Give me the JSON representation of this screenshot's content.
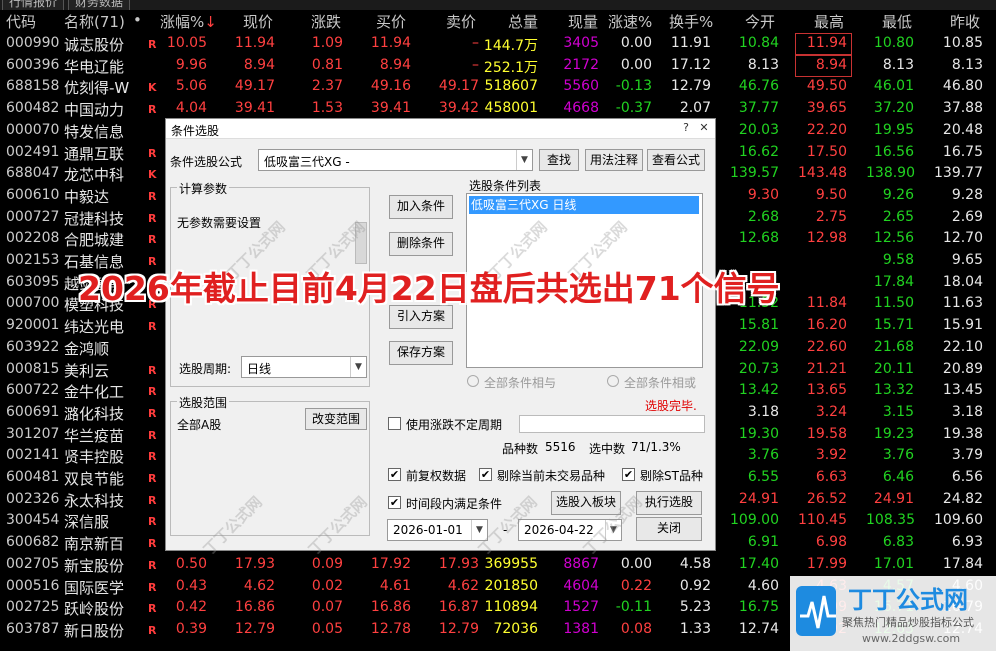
{
  "tabs": [
    "行情报价",
    "财务数据"
  ],
  "header": {
    "code": "代码",
    "name": "名称(71)",
    "dot": "•",
    "pct": "涨幅%",
    "pct_arrow": "↓",
    "price": "现价",
    "chg": "涨跌",
    "bid": "买价",
    "ask": "卖价",
    "vol": "总量",
    "cur": "现量",
    "speed": "涨速%",
    "turn": "换手%",
    "open": "今开",
    "high": "最高",
    "low": "最低",
    "prev": "昨收"
  },
  "colors": {
    "up": "#ff4040",
    "down": "#21d321",
    "flat": "#e8e8e8",
    "volume": "#ffff30",
    "current": "#d000d0"
  },
  "rows": [
    {
      "code": "000990",
      "name": "诚志股份",
      "mark": "R",
      "pct": "10.05",
      "price": "11.94",
      "chg": "1.09",
      "bid": "11.94",
      "ask": "–",
      "vol": "144.7万",
      "cur": "3405",
      "speed": "0.00",
      "turn": "11.91",
      "open": "10.84",
      "high": "11.94",
      "low": "10.80",
      "prev": "10.85"
    },
    {
      "code": "600396",
      "name": "华电辽能",
      "mark": "",
      "pct": "9.96",
      "price": "8.94",
      "chg": "0.81",
      "bid": "8.94",
      "ask": "–",
      "vol": "252.1万",
      "cur": "2172",
      "speed": "0.00",
      "turn": "17.12",
      "open": "8.13",
      "high": "8.94",
      "low": "8.13",
      "prev": "8.13"
    },
    {
      "code": "688158",
      "name": "优刻得-W",
      "mark": "K",
      "pct": "5.06",
      "price": "49.17",
      "chg": "2.37",
      "bid": "49.16",
      "ask": "49.17",
      "vol": "518607",
      "cur": "5560",
      "speed": "-0.13",
      "turn": "12.79",
      "open": "46.76",
      "high": "49.50",
      "low": "46.01",
      "prev": "46.80"
    },
    {
      "code": "600482",
      "name": "中国动力",
      "mark": "R",
      "pct": "4.04",
      "price": "39.41",
      "chg": "1.53",
      "bid": "39.41",
      "ask": "39.42",
      "vol": "458001",
      "cur": "4668",
      "speed": "-0.37",
      "turn": "2.07",
      "open": "37.77",
      "high": "39.65",
      "low": "37.20",
      "prev": "37.88"
    },
    {
      "code": "000070",
      "name": "特发信息",
      "mark": "",
      "pct": "",
      "price": "",
      "chg": "",
      "bid": "",
      "ask": "",
      "vol": "",
      "cur": "",
      "speed": "",
      "turn": "",
      "open": "20.03",
      "high": "22.20",
      "low": "19.95",
      "prev": "20.48"
    },
    {
      "code": "002491",
      "name": "通鼎互联",
      "mark": "R",
      "pct": "",
      "price": "",
      "chg": "",
      "bid": "",
      "ask": "",
      "vol": "",
      "cur": "",
      "speed": "",
      "turn": "",
      "open": "16.62",
      "high": "17.50",
      "low": "16.56",
      "prev": "16.75"
    },
    {
      "code": "688047",
      "name": "龙芯中科",
      "mark": "K",
      "pct": "",
      "price": "",
      "chg": "",
      "bid": "",
      "ask": "",
      "vol": "",
      "cur": "",
      "speed": "",
      "turn": "",
      "open": "139.57",
      "high": "143.48",
      "low": "138.90",
      "prev": "139.77"
    },
    {
      "code": "600610",
      "name": "中毅达",
      "mark": "R",
      "pct": "",
      "price": "",
      "chg": "",
      "bid": "",
      "ask": "",
      "vol": "",
      "cur": "",
      "speed": "",
      "turn": "",
      "open": "9.30",
      "high": "9.50",
      "low": "9.26",
      "prev": "9.28"
    },
    {
      "code": "000727",
      "name": "冠捷科技",
      "mark": "R",
      "pct": "",
      "price": "",
      "chg": "",
      "bid": "",
      "ask": "",
      "vol": "",
      "cur": "",
      "speed": "",
      "turn": "",
      "open": "2.68",
      "high": "2.75",
      "low": "2.65",
      "prev": "2.69"
    },
    {
      "code": "002208",
      "name": "合肥城建",
      "mark": "R",
      "pct": "",
      "price": "",
      "chg": "",
      "bid": "",
      "ask": "",
      "vol": "",
      "cur": "",
      "speed": "",
      "turn": "",
      "open": "12.68",
      "high": "12.98",
      "low": "12.56",
      "prev": "12.70"
    },
    {
      "code": "002153",
      "name": "石基信息",
      "mark": "R",
      "pct": "",
      "price": "",
      "chg": "",
      "bid": "",
      "ask": "",
      "vol": "",
      "cur": "",
      "speed": "",
      "turn": "",
      "open": "",
      "high": "",
      "low": "9.58",
      "prev": "9.65"
    },
    {
      "code": "603095",
      "name": "越剑智能",
      "mark": "",
      "pct": "",
      "price": "",
      "chg": "",
      "bid": "",
      "ask": "",
      "vol": "",
      "cur": "",
      "speed": "",
      "turn": "",
      "open": "",
      "high": "",
      "low": "17.84",
      "prev": "18.04"
    },
    {
      "code": "000700",
      "name": "模塑科技",
      "mark": "R",
      "pct": "",
      "price": "",
      "chg": "",
      "bid": "",
      "ask": "",
      "vol": "",
      "cur": "",
      "speed": "",
      "turn": "",
      "open": "11.52",
      "high": "11.84",
      "low": "11.50",
      "prev": "11.63"
    },
    {
      "code": "920001",
      "name": "纬达光电",
      "mark": "R",
      "pct": "",
      "price": "",
      "chg": "",
      "bid": "",
      "ask": "",
      "vol": "",
      "cur": "",
      "speed": "",
      "turn": "",
      "open": "15.81",
      "high": "16.20",
      "low": "15.71",
      "prev": "15.91"
    },
    {
      "code": "603922",
      "name": "金鸿顺",
      "mark": "",
      "pct": "",
      "price": "",
      "chg": "",
      "bid": "",
      "ask": "",
      "vol": "",
      "cur": "",
      "speed": "",
      "turn": "",
      "open": "22.09",
      "high": "22.60",
      "low": "21.68",
      "prev": "22.10"
    },
    {
      "code": "000815",
      "name": "美利云",
      "mark": "R",
      "pct": "",
      "price": "",
      "chg": "",
      "bid": "",
      "ask": "",
      "vol": "",
      "cur": "",
      "speed": "",
      "turn": "",
      "open": "20.73",
      "high": "21.21",
      "low": "20.11",
      "prev": "20.89"
    },
    {
      "code": "600722",
      "name": "金牛化工",
      "mark": "R",
      "pct": "",
      "price": "",
      "chg": "",
      "bid": "",
      "ask": "",
      "vol": "",
      "cur": "",
      "speed": "",
      "turn": "",
      "open": "13.42",
      "high": "13.65",
      "low": "13.32",
      "prev": "13.45"
    },
    {
      "code": "600691",
      "name": "潞化科技",
      "mark": "R",
      "pct": "",
      "price": "",
      "chg": "",
      "bid": "",
      "ask": "",
      "vol": "",
      "cur": "",
      "speed": "",
      "turn": "",
      "open": "3.18",
      "high": "3.24",
      "low": "3.15",
      "prev": "3.18"
    },
    {
      "code": "301207",
      "name": "华兰疫苗",
      "mark": "R",
      "pct": "",
      "price": "",
      "chg": "",
      "bid": "",
      "ask": "",
      "vol": "",
      "cur": "",
      "speed": "",
      "turn": "",
      "open": "19.30",
      "high": "19.58",
      "low": "19.23",
      "prev": "19.38"
    },
    {
      "code": "002141",
      "name": "贤丰控股",
      "mark": "R",
      "pct": "",
      "price": "",
      "chg": "",
      "bid": "",
      "ask": "",
      "vol": "",
      "cur": "",
      "speed": "",
      "turn": "",
      "open": "3.76",
      "high": "3.92",
      "low": "3.76",
      "prev": "3.79"
    },
    {
      "code": "600481",
      "name": "双良节能",
      "mark": "R",
      "pct": "",
      "price": "",
      "chg": "",
      "bid": "",
      "ask": "",
      "vol": "",
      "cur": "",
      "speed": "",
      "turn": "",
      "open": "6.55",
      "high": "6.63",
      "low": "6.46",
      "prev": "6.56"
    },
    {
      "code": "002326",
      "name": "永太科技",
      "mark": "R",
      "pct": "",
      "price": "",
      "chg": "",
      "bid": "",
      "ask": "",
      "vol": "",
      "cur": "",
      "speed": "",
      "turn": "",
      "open": "24.91",
      "high": "26.52",
      "low": "24.91",
      "prev": "24.82"
    },
    {
      "code": "300454",
      "name": "深信服",
      "mark": "R",
      "pct": "",
      "price": "",
      "chg": "",
      "bid": "",
      "ask": "",
      "vol": "",
      "cur": "",
      "speed": "",
      "turn": "",
      "open": "109.00",
      "high": "110.45",
      "low": "108.35",
      "prev": "109.60"
    },
    {
      "code": "600682",
      "name": "南京新百",
      "mark": "R",
      "pct": "",
      "price": "",
      "chg": "",
      "bid": "",
      "ask": "",
      "vol": "",
      "cur": "",
      "speed": "",
      "turn": "",
      "open": "6.91",
      "high": "6.98",
      "low": "6.83",
      "prev": "6.93"
    },
    {
      "code": "002705",
      "name": "新宝股份",
      "mark": "R",
      "pct": "0.50",
      "price": "17.93",
      "chg": "0.09",
      "bid": "17.92",
      "ask": "17.93",
      "vol": "369955",
      "cur": "8867",
      "speed": "0.00",
      "turn": "4.58",
      "open": "17.40",
      "high": "17.99",
      "low": "17.01",
      "prev": "17.84"
    },
    {
      "code": "000516",
      "name": "国际医学",
      "mark": "R",
      "pct": "0.43",
      "price": "4.62",
      "chg": "0.02",
      "bid": "4.61",
      "ask": "4.62",
      "vol": "201850",
      "cur": "4604",
      "speed": "0.22",
      "turn": "0.92",
      "open": "4.60",
      "high": "4.63",
      "low": "4.57",
      "prev": "4.60"
    },
    {
      "code": "002725",
      "name": "跃岭股份",
      "mark": "R",
      "pct": "0.42",
      "price": "16.86",
      "chg": "0.07",
      "bid": "16.86",
      "ask": "16.87",
      "vol": "110894",
      "cur": "1527",
      "speed": "-0.11",
      "turn": "5.23",
      "open": "16.75",
      "high": "16.99",
      "low": "16.71",
      "prev": "16.79"
    },
    {
      "code": "603787",
      "name": "新日股份",
      "mark": "R",
      "pct": "0.39",
      "price": "12.79",
      "chg": "0.05",
      "bid": "12.78",
      "ask": "12.79",
      "vol": "72036",
      "cur": "1381",
      "speed": "0.08",
      "turn": "1.33",
      "open": "12.74",
      "high": "12.92",
      "low": "12.63",
      "prev": "12.74"
    }
  ],
  "banner": "2026年截止目前4月22日盘后共选出71个信号",
  "dialog": {
    "title": "条件选股",
    "formula_label": "条件选股公式",
    "formula_value": "低吸富三代XG  -",
    "btn_find": "查找",
    "btn_usage": "用法注释",
    "btn_view": "查看公式",
    "params_title": "计算参数",
    "params_text": "无参数需要设置",
    "period_label": "选股周期:",
    "period_value": "日线",
    "list_title": "选股条件列表",
    "list_item": "低吸富三代XG  日线",
    "btn_add": "加入条件",
    "btn_delete": "删除条件",
    "btn_import": "引入方案",
    "btn_save": "保存方案",
    "radio_and": "全部条件相与",
    "radio_or": "全部条件相或",
    "status": "选股完毕.",
    "range_title": "选股范围",
    "range_value": "全部A股",
    "btn_range": "改变范围",
    "use_label": "使用涨跌不定周期",
    "count_label": "品种数",
    "count_value": "5516",
    "hit_label": "选中数",
    "hit_value": "71/1.3%",
    "chk_fq": "前复权数据",
    "chk_exclude_now": "剔除当前未交易品种",
    "chk_exclude_st": "剔除ST品种",
    "chk_time": "时间段内满足条件",
    "btn_board": "选股入板块",
    "btn_exec": "执行选股",
    "date_from": "2026-01-01",
    "date_sep": "-",
    "date_to": "2026-04-22",
    "btn_close": "关闭"
  },
  "watermark": {
    "text": "丁丁公式网",
    "logo_text": "丁丁公式网",
    "logo_sub": "聚焦热门精品炒股指标公式",
    "logo_url": "www.2ddgsw.com"
  }
}
